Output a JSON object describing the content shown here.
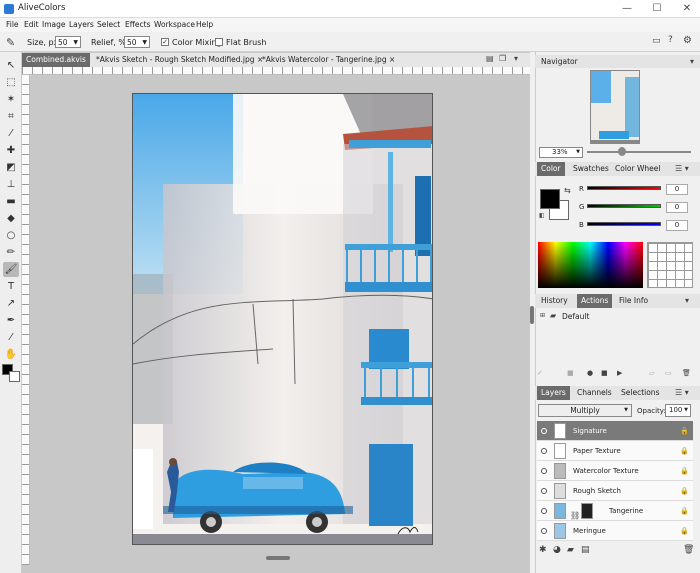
{
  "window": {
    "title": "AliveColors",
    "min": "—",
    "max": "☐",
    "close": "✕"
  },
  "menu": [
    "File",
    "Edit",
    "Image",
    "Layers",
    "Select",
    "Effects",
    "Workspace",
    "Help"
  ],
  "options": {
    "size_label": "Size, px",
    "size_value": "50",
    "relief_label": "Relief, %",
    "relief_value": "50",
    "color_mixing": "Color Mixing",
    "color_mixing_checked": "✓",
    "flat_brush": "Flat Brush"
  },
  "tabs": [
    {
      "label": "Combined.akvis",
      "close": "×"
    },
    {
      "label": "*Akvis Sketch - Rough Sketch Modified.jpg",
      "close": "×"
    },
    {
      "label": "*Akvis Watercolor - Tangerine.jpg",
      "close": "×"
    }
  ],
  "navigator": {
    "title": "Navigator",
    "zoom": "33%"
  },
  "color": {
    "tabs": [
      "Color",
      "Swatches",
      "Color Wheel"
    ],
    "r_label": "R",
    "g_label": "G",
    "b_label": "B",
    "r": "0",
    "g": "0",
    "b": "0",
    "fg": "#000000",
    "bg": "#ffffff"
  },
  "history": {
    "tabs": [
      "History",
      "Actions",
      "File Info"
    ],
    "default": "Default"
  },
  "layers": {
    "tabs": [
      "Layers",
      "Channels",
      "Selections"
    ],
    "blend": "Multiply",
    "opacity_label": "Opacity:",
    "opacity": "100",
    "items": [
      "Signature",
      "Paper Texture",
      "Watercolor Texture",
      "Rough Sketch",
      "Tangerine",
      "Meringue"
    ]
  }
}
